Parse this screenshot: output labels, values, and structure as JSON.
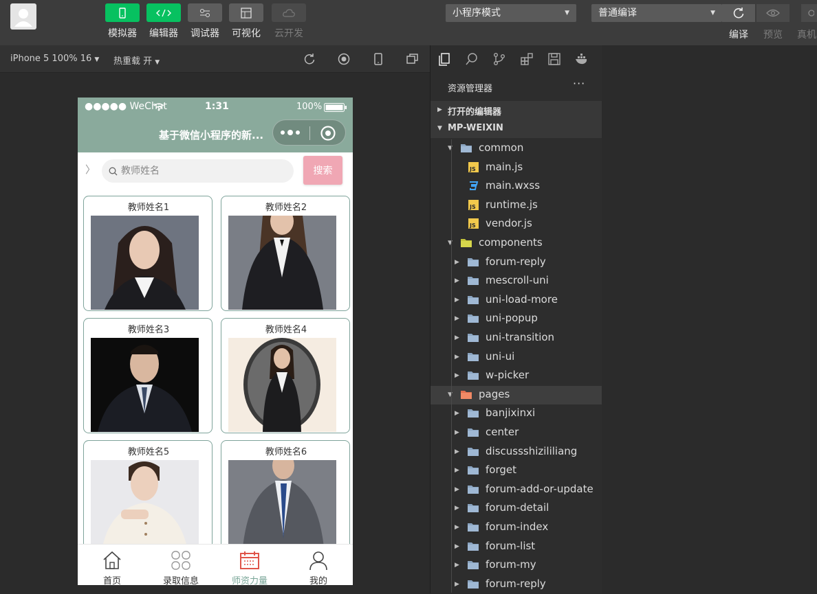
{
  "toolbar": {
    "tools": [
      {
        "label": "模拟器",
        "icon": "phone-icon"
      },
      {
        "label": "编辑器",
        "icon": "code-icon"
      },
      {
        "label": "调试器",
        "icon": "debug-icon"
      },
      {
        "label": "可视化",
        "icon": "layout-icon"
      },
      {
        "label": "云开发",
        "icon": "cloud-icon"
      }
    ],
    "mode_select": "小程序模式",
    "compile_select": "普通编译",
    "compile_label": "编译",
    "preview_label": "预览",
    "device_label": "真机"
  },
  "simbar": {
    "device": "iPhone 5 100% 16",
    "hot_reload": "热重载 开"
  },
  "phone": {
    "status": {
      "carrier": "●●●●● WeChat",
      "time": "1:31",
      "battery": "100%"
    },
    "nav_title": "基于微信小程序的新...",
    "search_placeholder": "教师姓名",
    "search_button": "搜索",
    "cards": [
      {
        "name": "教师姓名1"
      },
      {
        "name": "教师姓名2"
      },
      {
        "name": "教师姓名3"
      },
      {
        "name": "教师姓名4"
      },
      {
        "name": "教师姓名5"
      },
      {
        "name": "教师姓名6"
      }
    ],
    "tabs": [
      {
        "label": "首页",
        "icon": "home-icon"
      },
      {
        "label": "录取信息",
        "icon": "clover-icon"
      },
      {
        "label": "师资力量",
        "icon": "calendar-icon"
      },
      {
        "label": "我的",
        "icon": "user-icon"
      }
    ],
    "active_tab": "师资力量",
    "theme_color": "#8aaa9c",
    "button_color": "#f0a7b4"
  },
  "explorer": {
    "title": "资源管理器",
    "more": "···",
    "open_editors": "打开的编辑器",
    "root": "MP-WEIXIN",
    "tree": [
      {
        "name": "common",
        "type": "folder-open"
      },
      {
        "name": "main.js",
        "type": "js"
      },
      {
        "name": "main.wxss",
        "type": "css"
      },
      {
        "name": "runtime.js",
        "type": "js"
      },
      {
        "name": "vendor.js",
        "type": "js"
      },
      {
        "name": "components",
        "type": "folder-components"
      },
      {
        "name": "forum-reply",
        "type": "folder"
      },
      {
        "name": "mescroll-uni",
        "type": "folder"
      },
      {
        "name": "uni-load-more",
        "type": "folder"
      },
      {
        "name": "uni-popup",
        "type": "folder"
      },
      {
        "name": "uni-transition",
        "type": "folder"
      },
      {
        "name": "uni-ui",
        "type": "folder"
      },
      {
        "name": "w-picker",
        "type": "folder"
      },
      {
        "name": "pages",
        "type": "folder-pages"
      },
      {
        "name": "banjixinxi",
        "type": "folder"
      },
      {
        "name": "center",
        "type": "folder"
      },
      {
        "name": "discussshizililiang",
        "type": "folder"
      },
      {
        "name": "forget",
        "type": "folder"
      },
      {
        "name": "forum-add-or-update",
        "type": "folder"
      },
      {
        "name": "forum-detail",
        "type": "folder"
      },
      {
        "name": "forum-index",
        "type": "folder"
      },
      {
        "name": "forum-list",
        "type": "folder"
      },
      {
        "name": "forum-my",
        "type": "folder"
      },
      {
        "name": "forum-reply",
        "type": "folder"
      }
    ]
  }
}
